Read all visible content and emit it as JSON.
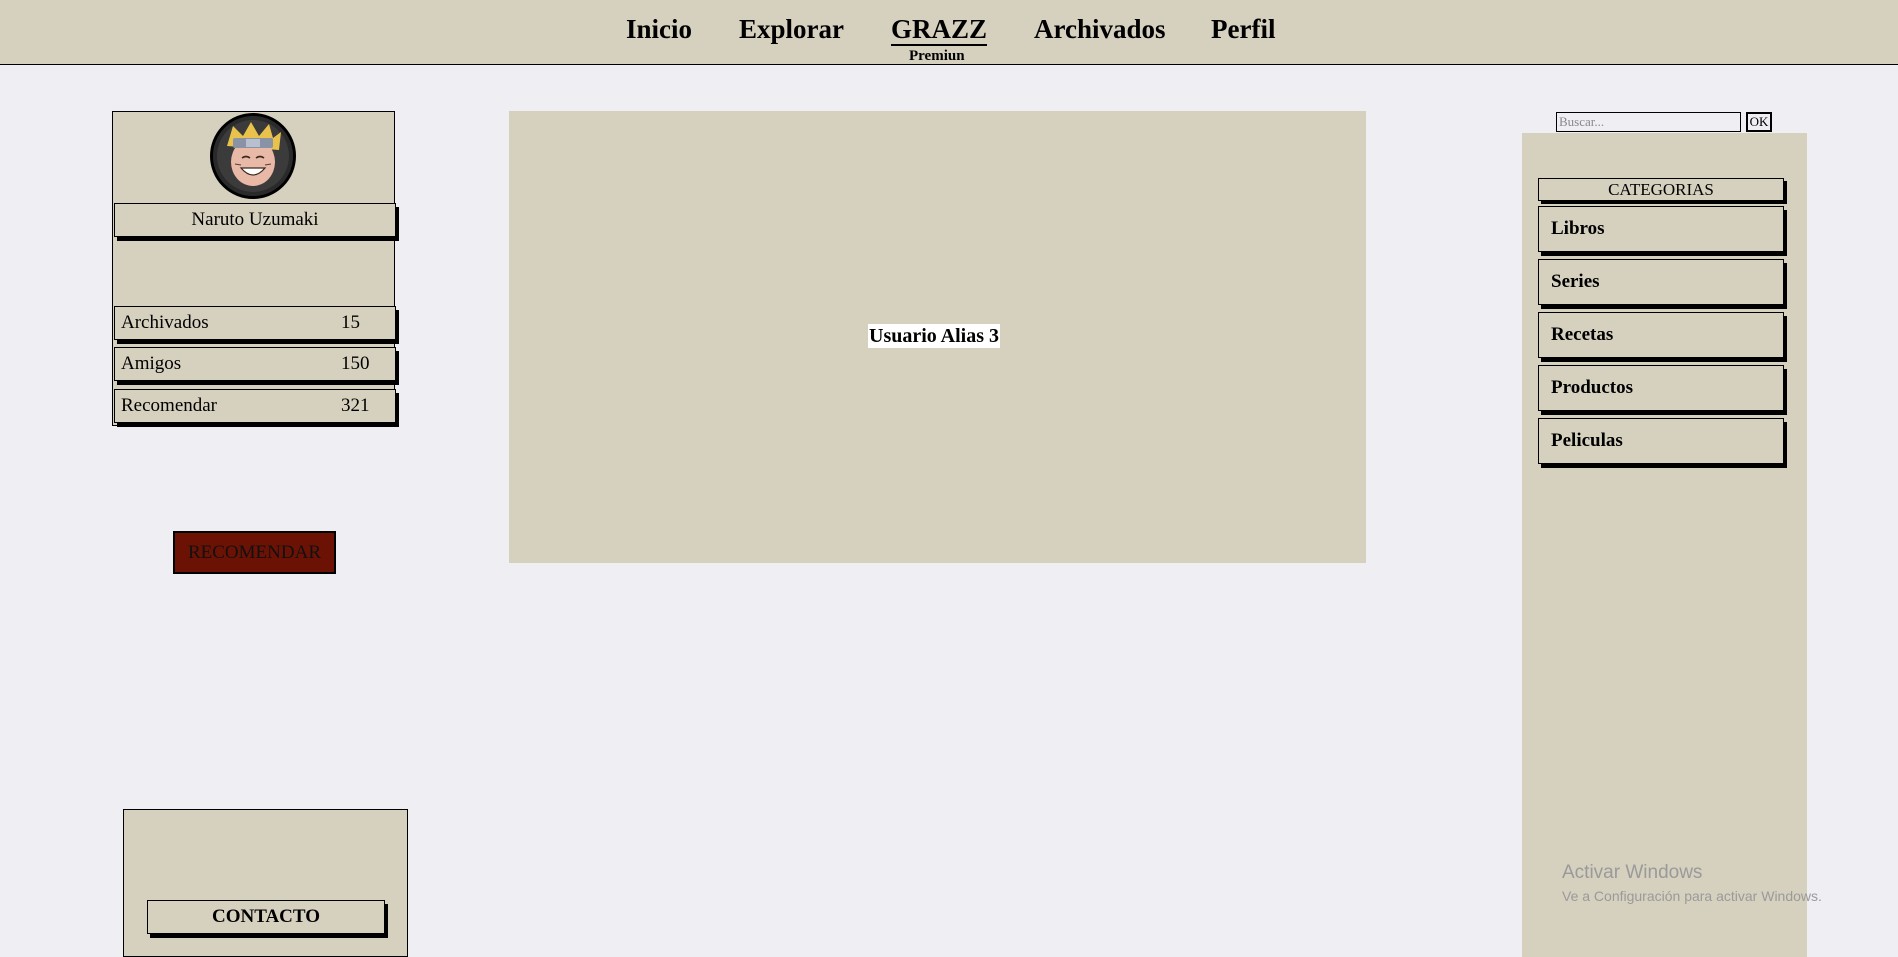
{
  "nav": {
    "items": [
      "Inicio",
      "Explorar",
      "GRAZZ",
      "Archivados",
      "Perfil"
    ],
    "grazz_sub": "Premiun"
  },
  "profile": {
    "name": "Naruto Uzumaki",
    "stats": [
      {
        "label": "Archivados",
        "value": "15"
      },
      {
        "label": "Amigos",
        "value": "150"
      },
      {
        "label": "Recomendar",
        "value": "321"
      }
    ],
    "recommend_button": "RECOMENDAR"
  },
  "contact": {
    "button": "CONTACTO"
  },
  "main": {
    "label": "Usuario Alias 3"
  },
  "search": {
    "placeholder": "Buscar...",
    "ok_label": "OK"
  },
  "categories": {
    "header": "CATEGORIAS",
    "items": [
      "Libros",
      "Series",
      "Recetas",
      "Productos",
      "Peliculas"
    ]
  },
  "watermark": {
    "title": "Activar Windows",
    "subtitle": "Ve a Configuración para activar Windows."
  },
  "colors": {
    "panel": "#d6d0bf",
    "background": "#efeff3",
    "recommend_button": "#6b1205"
  }
}
